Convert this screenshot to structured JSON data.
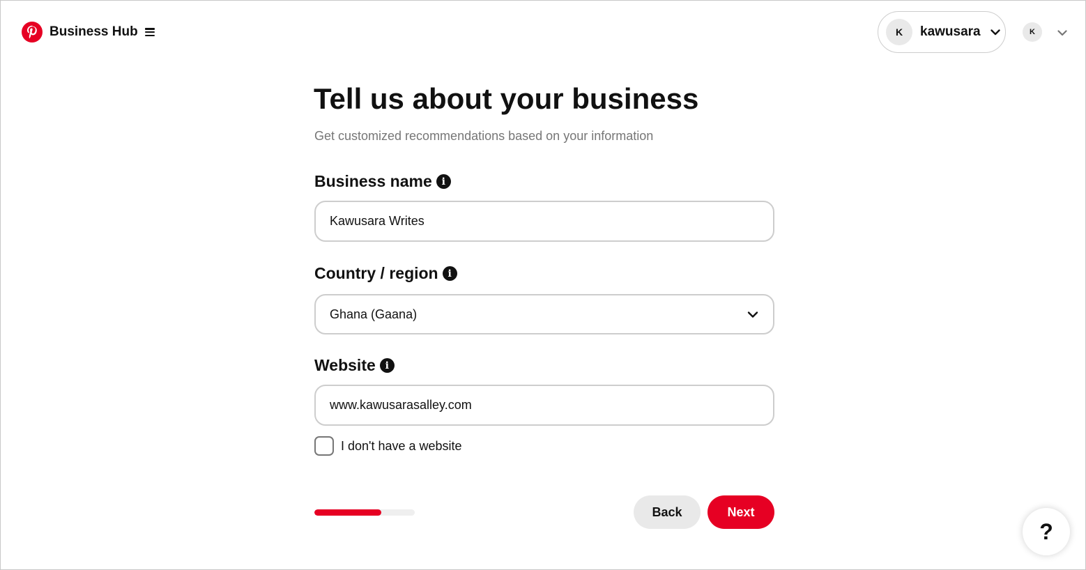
{
  "header": {
    "brand_title": "Business Hub",
    "account": {
      "initial": "K",
      "name": "kawusara"
    },
    "small_avatar_initial": "K"
  },
  "form": {
    "title": "Tell us about your business",
    "subtitle": "Get customized recommendations based on your information",
    "business_name": {
      "label": "Business name",
      "value": "Kawusara Writes"
    },
    "country": {
      "label": "Country / region",
      "selected": "Ghana (Gaana)"
    },
    "website": {
      "label": "Website",
      "value": "www.kawusarasalley.com"
    },
    "no_website_checkbox": {
      "label": "I don't have a website",
      "checked": false
    },
    "progress_fraction": 0.67,
    "back_label": "Back",
    "next_label": "Next"
  },
  "help_button_label": "?",
  "icons": {
    "brand": "pinterest-logo-icon",
    "menu": "hamburger-menu-icon",
    "dropdown": "chevron-down-icon",
    "info": "info-icon"
  },
  "colors": {
    "accent": "#e60023",
    "muted_text": "#767676",
    "border": "#cdcdcd",
    "secondary_button": "#e9e9e9"
  }
}
